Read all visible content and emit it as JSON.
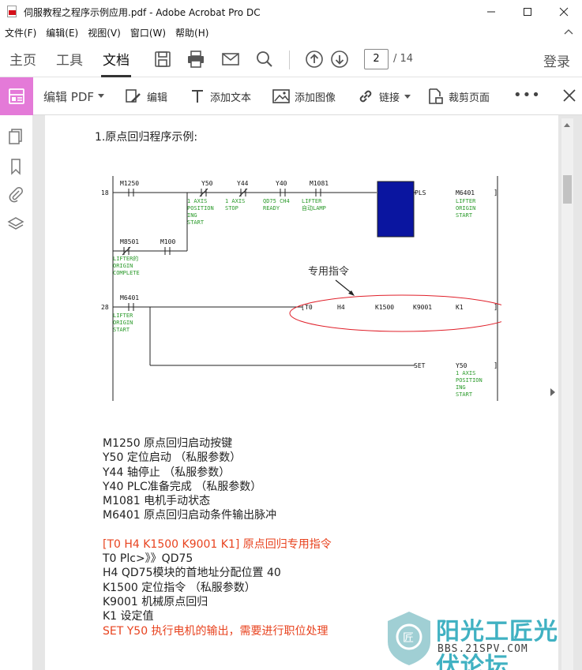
{
  "window": {
    "title": "伺服教程之程序示例应用.pdf - Adobe Acrobat Pro DC"
  },
  "menu": [
    "文件(F)",
    "编辑(E)",
    "视图(V)",
    "窗口(W)",
    "帮助(H)"
  ],
  "tabs": {
    "home": "主页",
    "tools": "工具",
    "document": "文档"
  },
  "page_nav": {
    "current": "2",
    "total": "/ 14"
  },
  "login": "登录",
  "edit_toolbar": {
    "title": "编辑 PDF",
    "edit": "编辑",
    "add_text": "添加文本",
    "add_image": "添加图像",
    "link": "链接",
    "crop": "裁剪页面"
  },
  "document": {
    "heading": "1.原点回归程序示例:",
    "callout": "专用指令",
    "ladder": {
      "rung1_no": "18",
      "rung2_no": "28",
      "m1250": "M1250",
      "y50": "Y50",
      "y44": "Y44",
      "y40": "Y40",
      "m1081": "M1081",
      "y50_c1": "1 AXIS",
      "y50_c2": "POSITION",
      "y50_c3": "ING",
      "y50_c4": "START",
      "y44_c1": "1 AXIS",
      "y44_c2": "STOP",
      "y40_c1": "QD75 CH4",
      "y40_c2": "READY",
      "m1081_c1": "LIFTER",
      "m1081_c2": "自动LAMP",
      "pls": "PLS",
      "m6401_coil": "M6401",
      "coil1_c1": "LIFTER",
      "coil1_c2": "ORIGIN",
      "coil1_c3": "START",
      "m8501": "M8501",
      "m100": "M100",
      "m8501_c1": "LIFTER的",
      "m8501_c2": "ORIGIN",
      "m8501_c3": "COMPLETE",
      "m6401": "M6401",
      "m6401_c1": "LIFTER",
      "m6401_c2": "ORIGIN",
      "m6401_c3": "START",
      "t0": "T0",
      "h4": "H4",
      "k1500": "K1500",
      "k9001": "K9001",
      "k1": "K1",
      "set": "SET",
      "y50_coil": "Y50",
      "set_c1": "1 AXIS",
      "set_c2": "POSITION",
      "set_c3": "ING",
      "set_c4": "START"
    },
    "notes": [
      {
        "text": "M1250 原点回归启动按键",
        "color": "normal"
      },
      {
        "text": "Y50  定位启动 （私服参数）",
        "color": "normal"
      },
      {
        "text": "Y44  轴停止  （私服参数）",
        "color": "normal"
      },
      {
        "text": "Y40  PLC准备完成 （私服参数）",
        "color": "normal"
      },
      {
        "text": "M1081  电机手动状态",
        "color": "normal"
      },
      {
        "text": "M6401  原点回归启动条件输出脉冲",
        "color": "normal"
      }
    ],
    "notes2": [
      {
        "text": "[T0   H4   K1500  K9001 K1]  原点回归专用指令",
        "color": "red"
      },
      {
        "text": "T0  Plc>》》QD75",
        "color": "normal"
      },
      {
        "text": "H4  QD75模块的首地址分配位置 40",
        "color": "normal"
      },
      {
        "text": "K1500  定位指令 （私服参数）",
        "color": "normal"
      },
      {
        "text": "K9001  机械原点回归",
        "color": "normal"
      },
      {
        "text": "K1  设定值",
        "color": "normal"
      },
      {
        "text": "SET Y50  执行电机的输出，需要进行职位处理",
        "color": "red"
      }
    ]
  },
  "watermark": {
    "brand": "阳光工匠光伏论坛",
    "url": "BBS.21SPV.COM"
  },
  "colors": {
    "accent_pink": "#e47ad8",
    "ladder_green": "#2a9a2a",
    "block_blue": "#0a15a0",
    "note_red": "#e8431f",
    "ellipse_red": "#e0202a"
  }
}
